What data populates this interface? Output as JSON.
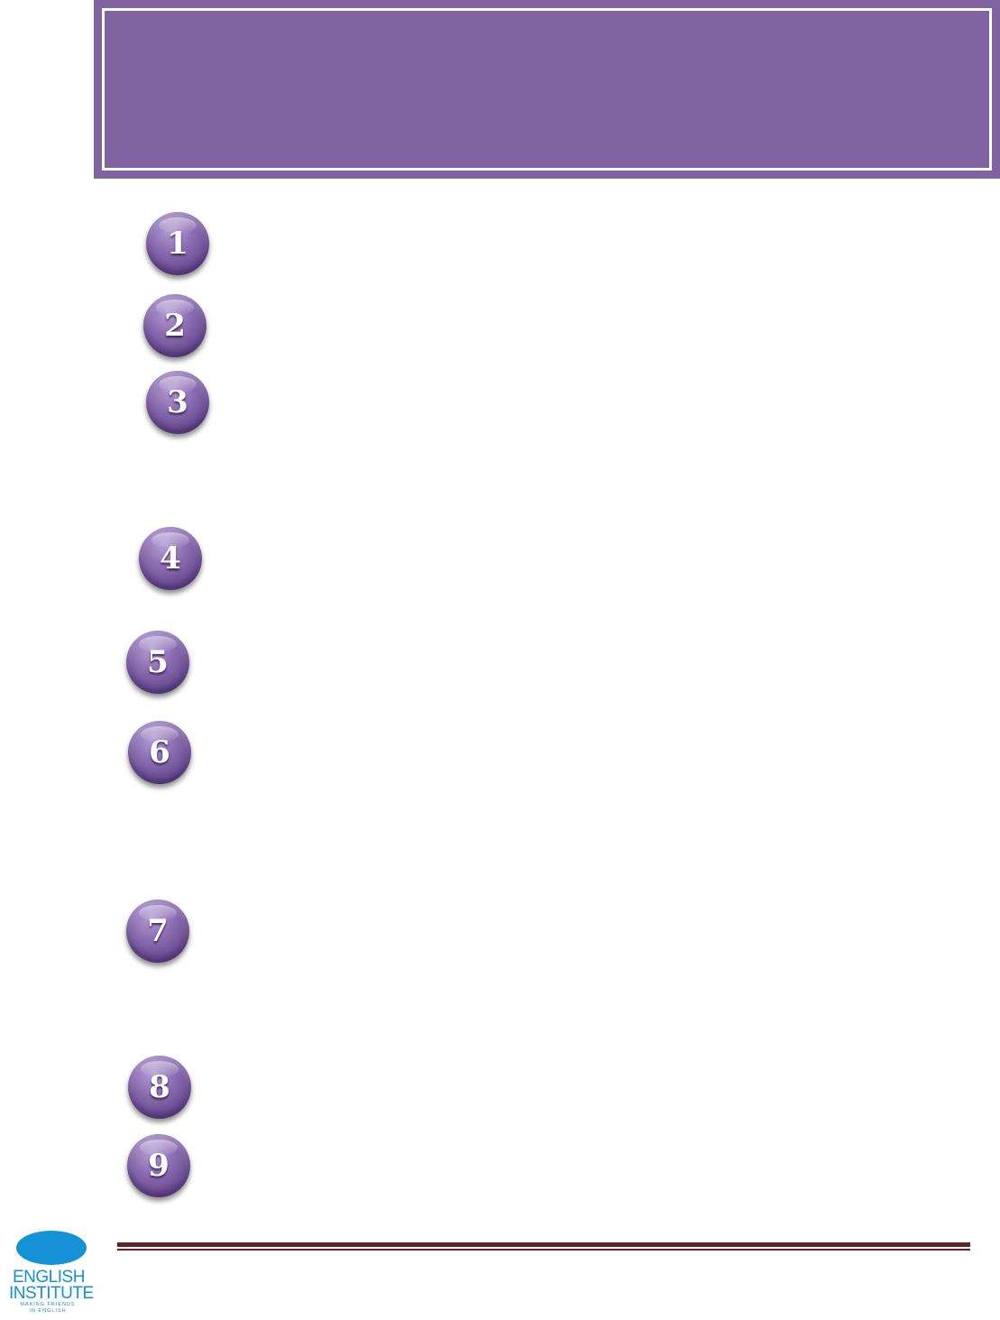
{
  "header": {
    "title": ""
  },
  "items": [
    {
      "number": "1"
    },
    {
      "number": "2"
    },
    {
      "number": "3"
    },
    {
      "number": "4"
    },
    {
      "number": "5"
    },
    {
      "number": "6"
    },
    {
      "number": "7"
    },
    {
      "number": "8"
    },
    {
      "number": "9"
    }
  ],
  "footer": {
    "logo": {
      "line1": "ENGLISH",
      "line2": "INSTITUTE",
      "tagline1": "MAKING FRIENDS",
      "tagline2": "IN ENGLISH"
    }
  },
  "colors": {
    "banner": "#8064a2",
    "bullet": "#7a5ea4",
    "rule": "#632523",
    "logo": "#1591d6"
  }
}
